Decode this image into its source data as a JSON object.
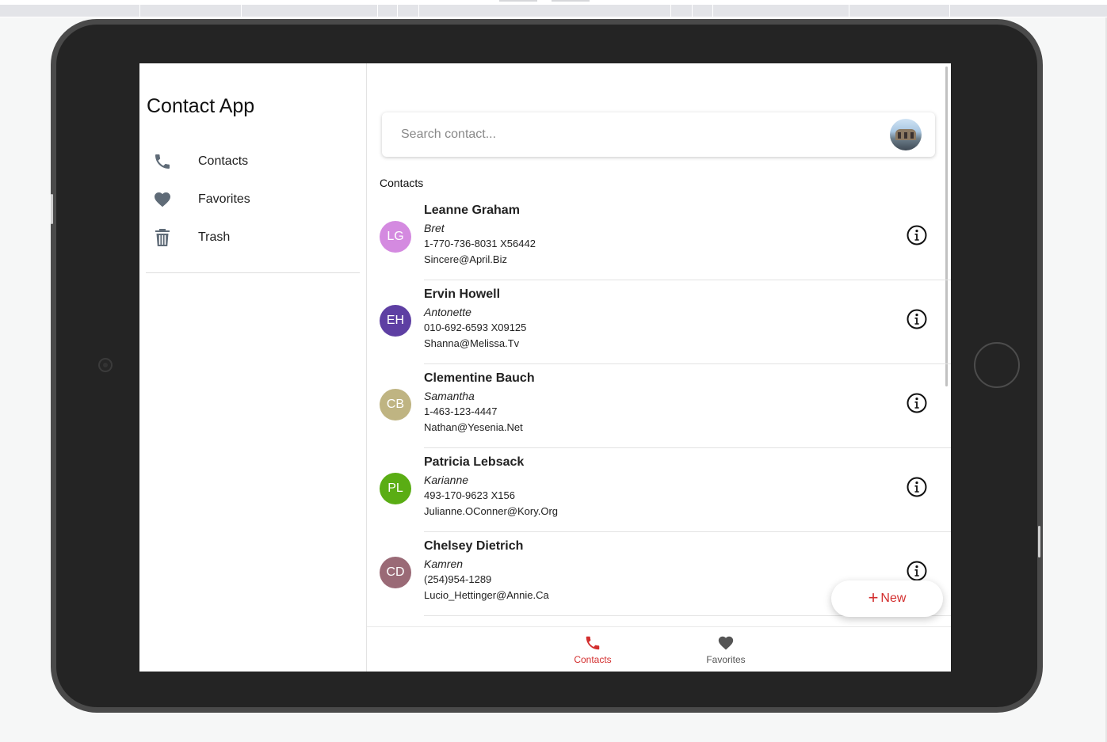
{
  "app": {
    "title": "Contact App"
  },
  "sidebar": {
    "items": [
      {
        "label": "Contacts",
        "icon": "phone-icon"
      },
      {
        "label": "Favorites",
        "icon": "heart-icon"
      },
      {
        "label": "Trash",
        "icon": "trash-icon"
      }
    ]
  },
  "search": {
    "placeholder": "Search contact...",
    "value": ""
  },
  "list": {
    "heading": "Contacts",
    "contacts": [
      {
        "initials": "LG",
        "name": "Leanne Graham",
        "username": "Bret",
        "phone": "1-770-736-8031 X56442",
        "email": "Sincere@April.Biz",
        "color": "#d48ae0"
      },
      {
        "initials": "EH",
        "name": "Ervin Howell",
        "username": "Antonette",
        "phone": "010-692-6593 X09125",
        "email": "Shanna@Melissa.Tv",
        "color": "#5e3fa3"
      },
      {
        "initials": "CB",
        "name": "Clementine Bauch",
        "username": "Samantha",
        "phone": "1-463-123-4447",
        "email": "Nathan@Yesenia.Net",
        "color": "#bfb482"
      },
      {
        "initials": "PL",
        "name": "Patricia Lebsack",
        "username": "Karianne",
        "phone": "493-170-9623 X156",
        "email": "Julianne.OConner@Kory.Org",
        "color": "#5aad14"
      },
      {
        "initials": "CD",
        "name": "Chelsey Dietrich",
        "username": "Kamren",
        "phone": "(254)954-1289",
        "email": "Lucio_Hettinger@Annie.Ca",
        "color": "#9a6a76"
      }
    ]
  },
  "fab": {
    "plus": "+",
    "label": "New"
  },
  "bottom_nav": {
    "items": [
      {
        "label": "Contacts",
        "icon": "phone-icon",
        "active": true
      },
      {
        "label": "Favorites",
        "icon": "heart-icon",
        "active": false
      }
    ]
  },
  "colors": {
    "accent": "#d32f2f",
    "icon_gray": "#5f6b77",
    "inactive": "#555555"
  }
}
